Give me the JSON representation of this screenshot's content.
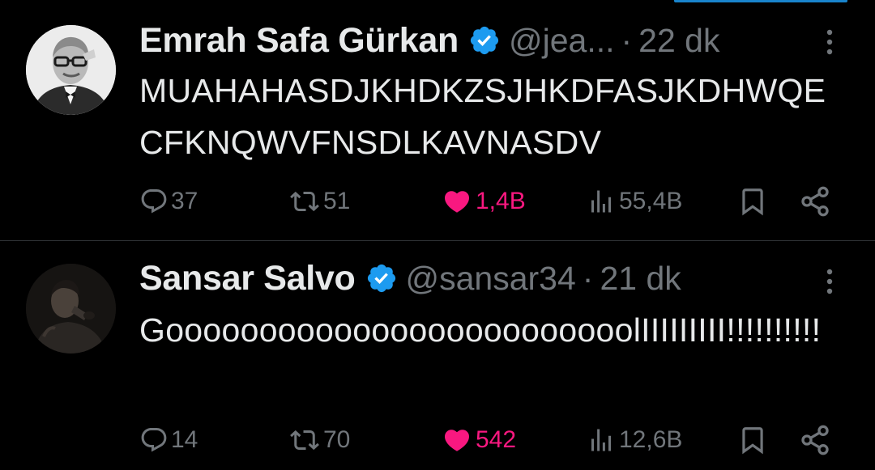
{
  "tweets": [
    {
      "author_name": "Emrah Safa Gürkan",
      "verified": true,
      "handle": "@jea...",
      "separator": "·",
      "time": "22 dk",
      "text": "MUAHAHASDJKHDKZSJHKDFASJKDHWQECFKNQWVFNSDLKAVNASDV",
      "replies": "37",
      "retweets": "51",
      "likes": "1,4B",
      "liked": true,
      "views": "55,4B"
    },
    {
      "author_name": "Sansar Salvo",
      "verified": true,
      "handle": "@sansar34",
      "separator": "·",
      "time": "21 dk",
      "text": "GooooooooooooooooooooooooolIIIIIIIII!!!!!!!!!!",
      "replies": "14",
      "retweets": "70",
      "likes": "542",
      "liked": true,
      "views": "12,6B"
    }
  ],
  "colors": {
    "background": "#000000",
    "text_primary": "#e7e9ea",
    "text_secondary": "#71767b",
    "like_active": "#f91880",
    "verified_badge": "#1d9bf0",
    "divider": "#2f3336"
  },
  "icons": [
    "reply-icon",
    "retweet-icon",
    "heart-icon",
    "views-icon",
    "bookmark-icon",
    "share-icon",
    "more-icon",
    "verified-badge-icon"
  ]
}
